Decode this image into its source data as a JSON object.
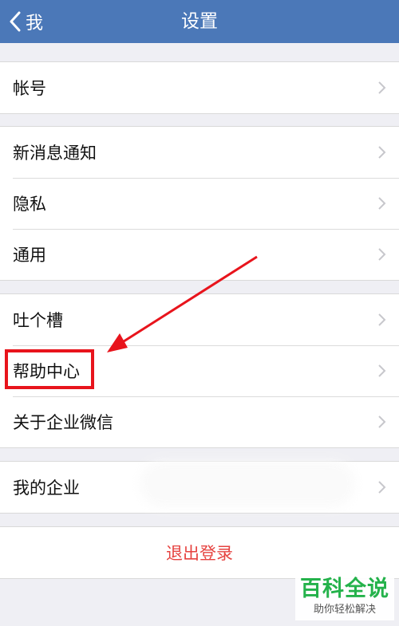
{
  "navbar": {
    "back_label": "我",
    "title": "设置"
  },
  "groups": {
    "account": [
      "帐号"
    ],
    "prefs": [
      "新消息通知",
      "隐私",
      "通用"
    ],
    "help": [
      "吐个槽",
      "帮助中心",
      "关于企业微信"
    ],
    "enterprise": [
      "我的企业"
    ]
  },
  "logout_label": "退出登录",
  "watermark": {
    "title": "百科全说",
    "subtitle": "助你轻松解决"
  },
  "colors": {
    "navbar": "#4b78b8",
    "background": "#efeff4",
    "logout_text": "#e64340",
    "annotation": "#e8141c",
    "watermark_title": "#24b24b"
  },
  "icons": {
    "back": "chevron-left-icon",
    "row_arrow": "chevron-right-icon"
  }
}
